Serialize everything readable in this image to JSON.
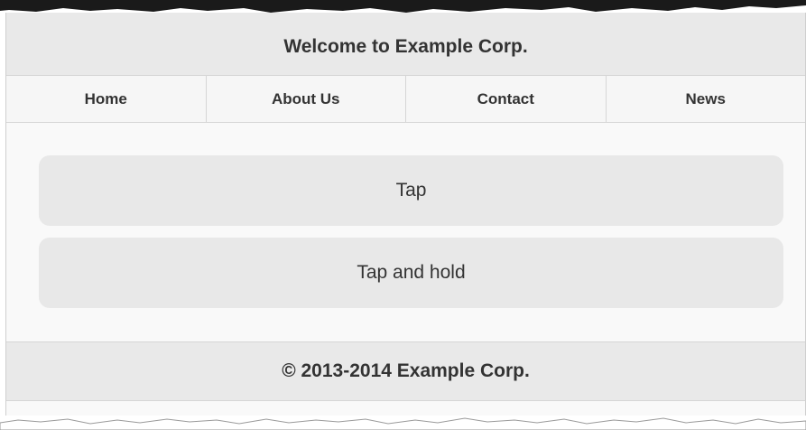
{
  "header": {
    "title": "Welcome to Example Corp."
  },
  "nav": {
    "items": [
      {
        "label": "Home"
      },
      {
        "label": "About Us"
      },
      {
        "label": "Contact"
      },
      {
        "label": "News"
      }
    ]
  },
  "content": {
    "tap_button": "Tap",
    "tap_hold_button": "Tap and hold"
  },
  "footer": {
    "text": "© 2013-2014 Example Corp."
  },
  "colors": {
    "header_bg": "#e9e9e9",
    "page_bg": "#f9f9f9",
    "button_bg": "#e8e8e8",
    "text": "#333333"
  }
}
